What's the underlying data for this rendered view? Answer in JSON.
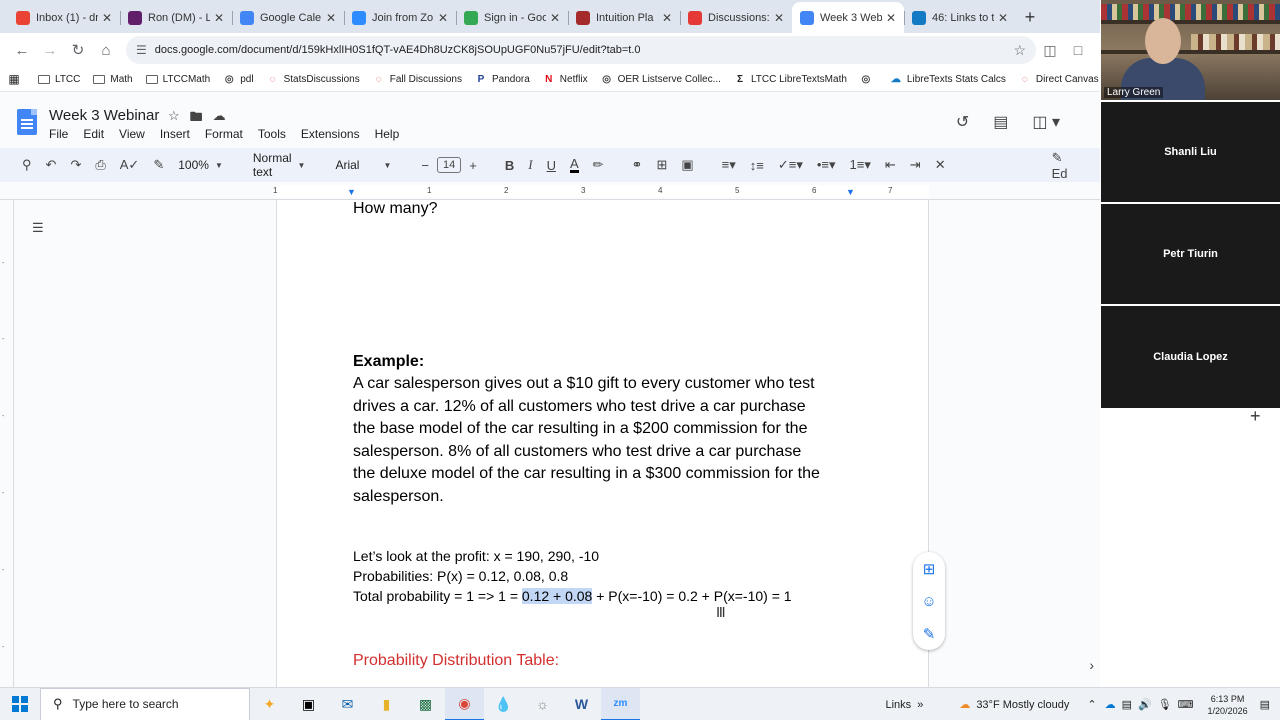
{
  "browser": {
    "tabs": [
      {
        "label": "Inbox (1) - dr",
        "icon": "gmail-icon",
        "color": "#ea4335",
        "active": false
      },
      {
        "label": "Ron (DM) - L",
        "icon": "slack-icon",
        "color": "#611f69",
        "active": false
      },
      {
        "label": "Google Cale",
        "icon": "calendar-icon",
        "color": "#4285f4",
        "active": false
      },
      {
        "label": "Join from Zo",
        "icon": "zoom-icon",
        "color": "#2d8cff",
        "active": false
      },
      {
        "label": "Sign in - Goo",
        "icon": "google-icon",
        "color": "#34a853",
        "active": false
      },
      {
        "label": "Intuition Pla",
        "icon": "check-icon",
        "color": "#a52a2a",
        "active": false
      },
      {
        "label": "Discussions:",
        "icon": "canvas-icon",
        "color": "#e53935",
        "active": false
      },
      {
        "label": "Week 3 Web",
        "icon": "docs-icon",
        "color": "#4285f4",
        "active": true
      },
      {
        "label": "46: Links to t",
        "icon": "libretexts-icon",
        "color": "#127bc4",
        "active": false
      }
    ],
    "new_tab": "+",
    "url": "docs.google.com/document/d/159kHxlIH0S1fQT-vAE4Dh8UzCK8jSOUpUGF0Nu57jFU/edit?tab=t.0",
    "bookmarks": [
      {
        "label": "LTCC",
        "icon": "folder-icon"
      },
      {
        "label": "Math",
        "icon": "folder-icon"
      },
      {
        "label": "LTCCMath",
        "icon": "folder-icon"
      },
      {
        "label": "pdl",
        "icon": "globe-icon"
      },
      {
        "label": "StatsDiscussions",
        "icon": "canvas-icon"
      },
      {
        "label": "Fall Discussions",
        "icon": "canvas-icon"
      },
      {
        "label": "Pandora",
        "icon": "pandora-icon"
      },
      {
        "label": "Netflix",
        "icon": "netflix-icon"
      },
      {
        "label": "OER Listserve Collec...",
        "icon": "globe-icon"
      },
      {
        "label": "LTCC LibreTextsMath",
        "icon": "sigma-icon"
      },
      {
        "label": "",
        "icon": "globe-icon"
      },
      {
        "label": "LibreTexts Stats Calcs",
        "icon": "libretexts-icon"
      },
      {
        "label": "Direct Canvas Lin",
        "icon": "canvas-icon"
      }
    ]
  },
  "docs": {
    "title": "Week 3 Webinar",
    "menu": [
      "File",
      "Edit",
      "View",
      "Insert",
      "Format",
      "Tools",
      "Extensions",
      "Help"
    ],
    "toolbar": {
      "zoom": "100%",
      "style": "Normal text",
      "font": "Arial",
      "size": "14",
      "edit_mode": "Ed"
    },
    "ruler_ticks": [
      "1",
      "1",
      "2",
      "3",
      "4",
      "5",
      "6",
      "7"
    ]
  },
  "content": {
    "how_many": "How many?",
    "example_heading": "Example:",
    "example_lines": [
      "A car salesperson gives out a $10 gift to every customer who test",
      "drives a car.  12% of all customers who test drive a car purchase",
      "the base model of the car resulting in a $200 commission for the",
      "salesperson.  8% of all customers who test drive a car purchase",
      "the deluxe model of the car resulting in a $300 commission for the",
      "salesperson."
    ],
    "profit_line": "Let’s look at the profit:  x = 190, 290, -10",
    "prob_line": "Probabilities:  P(x) = 0.12, 0.08, 0.8",
    "total_pre": "Total probability = 1 => 1 = ",
    "total_highlight": "0.12 + 0.08",
    "total_post": " + P(x=-10) = 0.2 + P(x=-10) = 1",
    "table_heading": "Probability Distribution Table:"
  },
  "zoom": {
    "participants": [
      {
        "name": "Larry Green",
        "video": true
      },
      {
        "name": "Shanli Liu",
        "video": false
      },
      {
        "name": "Petr Tiurin",
        "video": false
      },
      {
        "name": "Claudia Lopez",
        "video": false
      }
    ],
    "add_label": "+"
  },
  "taskbar": {
    "search_placeholder": "Type here to search",
    "links_label": "Links",
    "weather": "33°F  Mostly cloudy",
    "time": "6:13 PM",
    "date": "1/20/2026"
  },
  "colors": {
    "accent": "#1a73e8",
    "highlight": "#c2d7f6",
    "heading_red": "#d32f2f"
  }
}
